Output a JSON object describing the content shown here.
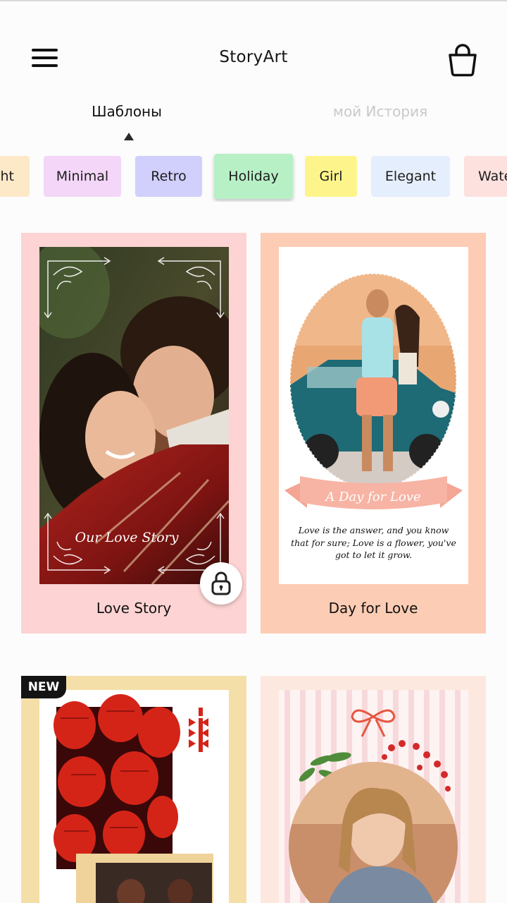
{
  "header": {
    "title": "StoryArt"
  },
  "tabs": [
    {
      "label": "Шаблоны",
      "active": true
    },
    {
      "label": "мой История",
      "active": false
    }
  ],
  "categories": [
    {
      "label": "Light",
      "color": "#fde8c8"
    },
    {
      "label": "Minimal",
      "color": "#f4d6f8"
    },
    {
      "label": "Retro",
      "color": "#d1cffb"
    },
    {
      "label": "Holiday",
      "color": "#b8f0c6",
      "selected": true
    },
    {
      "label": "Girl",
      "color": "#fdf58c"
    },
    {
      "label": "Elegant",
      "color": "#e5eefc"
    },
    {
      "label": "Watercolor",
      "color": "#fde1de"
    }
  ],
  "templates": [
    {
      "title": "Love Story",
      "frame_color": "#fdd3d3",
      "overlay_text": "Our Love Story",
      "locked": true
    },
    {
      "title": "Day for Love",
      "frame_color": "#fdccb4",
      "ribbon_text": "A Day for Love",
      "quote": "Love is the answer, and you know that for sure; Love is a flower, you've got to let it grow."
    },
    {
      "title": "",
      "frame_color": "#f5dfa9",
      "badge": "NEW"
    },
    {
      "title": "",
      "frame_color": "#fde8e0"
    }
  ],
  "colors": {
    "accent_text": "#111111",
    "inactive_tab": "#c9c9cc"
  }
}
